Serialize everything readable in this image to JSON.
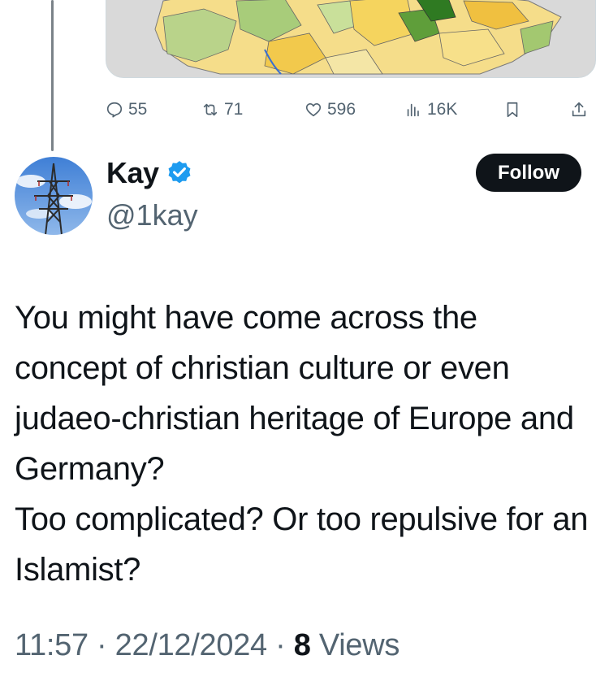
{
  "embedded_card": {
    "image": "map-of-germany-regions"
  },
  "action_bar": {
    "reply_count": "55",
    "repost_count": "71",
    "like_count": "596",
    "views_count": "16K",
    "icons": [
      "reply-icon",
      "repost-icon",
      "like-icon",
      "views-icon",
      "bookmark-icon",
      "share-icon"
    ]
  },
  "author": {
    "display_name": "Kay",
    "handle": "@1kay",
    "verified": true,
    "verified_color": "#1d9bf0",
    "avatar": "electricity-pylon-photo"
  },
  "follow_button": {
    "label": "Follow"
  },
  "tweet": {
    "lines": [
      "You might have come across the concept of christian culture or even judaeo-christian heritage of Europe and Germany?",
      "Too complicated? Or too repulsive for an Islamist?"
    ]
  },
  "meta": {
    "time": "11:57",
    "separator": "·",
    "date": "22/12/2024",
    "views_number": "8",
    "views_label": "Views"
  },
  "colors": {
    "text_primary": "#0f1419",
    "text_secondary": "#536471",
    "follow_bg": "#0f1419",
    "thread_line": "#7a8288"
  }
}
